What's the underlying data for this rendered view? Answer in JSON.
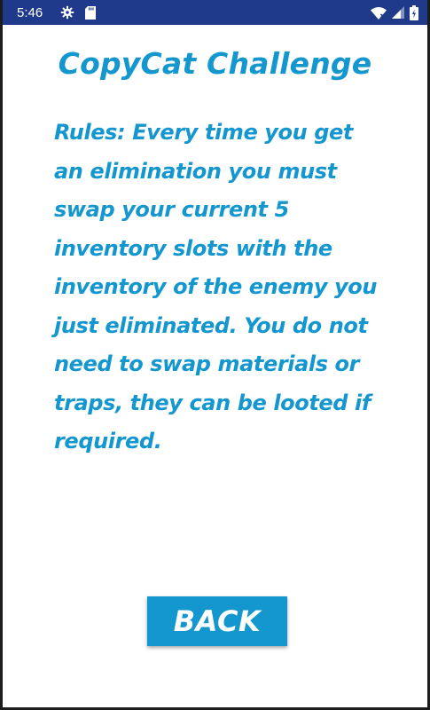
{
  "status_bar": {
    "time": "5:46",
    "background_color": "#1f3a8a",
    "left_icons": [
      "gear-icon",
      "sd-card-icon"
    ],
    "right_icons": [
      "wifi-icon",
      "cell-signal-icon",
      "battery-icon"
    ]
  },
  "screen": {
    "title": "CopyCat Challenge",
    "rules_text": "Rules: Every time you get an elimination you must swap your current 5 inventory slots with the inventory of the enemy you just eliminated. You do not need to swap materials or traps, they can be looted if required.",
    "back_label": "BACK"
  },
  "colors": {
    "accent": "#1496cf",
    "background": "#ffffff",
    "button_text": "#ffffff"
  }
}
